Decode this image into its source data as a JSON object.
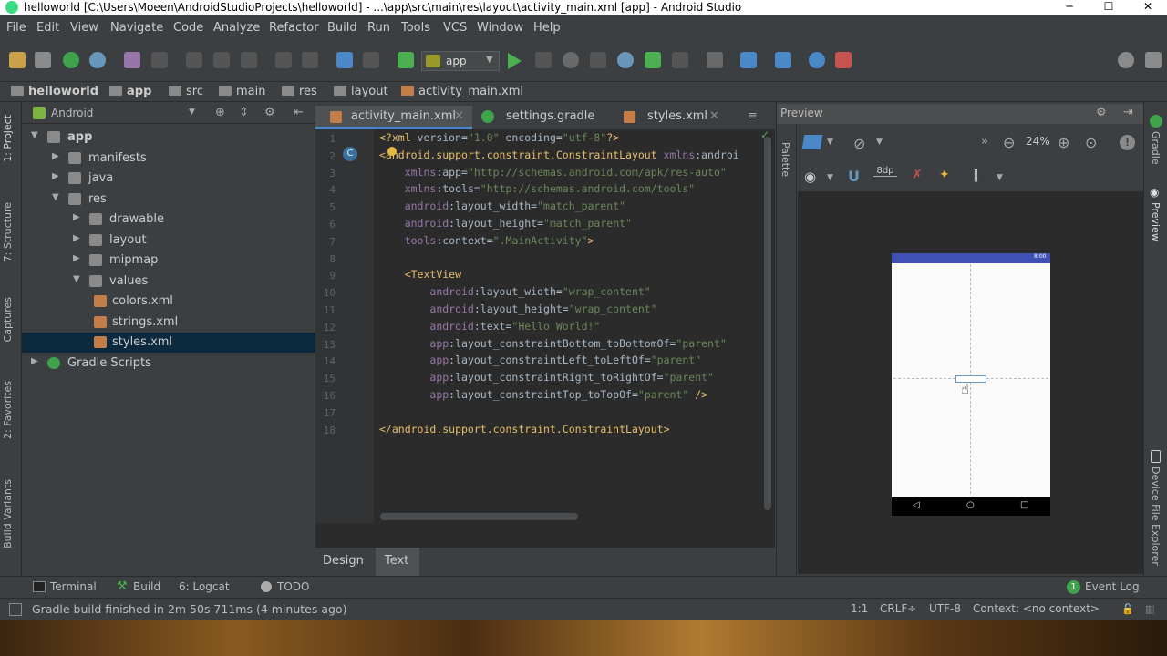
{
  "window": {
    "title": "helloworld [C:\\Users\\Moeen\\AndroidStudioProjects\\helloworld] - ...\\app\\src\\main\\res\\layout\\activity_main.xml [app] - Android Studio"
  },
  "menu": [
    "File",
    "Edit",
    "View",
    "Navigate",
    "Code",
    "Analyze",
    "Refactor",
    "Build",
    "Run",
    "Tools",
    "VCS",
    "Window",
    "Help"
  ],
  "toolbar": {
    "run_config": "app"
  },
  "breadcrumb": [
    "helloworld",
    "app",
    "src",
    "main",
    "res",
    "layout",
    "activity_main.xml"
  ],
  "project": {
    "view_mode": "Android",
    "tree": [
      {
        "label": "app",
        "depth": 0,
        "arrow": "down"
      },
      {
        "label": "manifests",
        "depth": 1,
        "arrow": "right"
      },
      {
        "label": "java",
        "depth": 1,
        "arrow": "right"
      },
      {
        "label": "res",
        "depth": 1,
        "arrow": "down"
      },
      {
        "label": "drawable",
        "depth": 2,
        "arrow": "right"
      },
      {
        "label": "layout",
        "depth": 2,
        "arrow": "right"
      },
      {
        "label": "mipmap",
        "depth": 2,
        "arrow": "right"
      },
      {
        "label": "values",
        "depth": 2,
        "arrow": "down"
      },
      {
        "label": "colors.xml",
        "depth": 3,
        "arrow": ""
      },
      {
        "label": "strings.xml",
        "depth": 3,
        "arrow": ""
      },
      {
        "label": "styles.xml",
        "depth": 3,
        "arrow": "",
        "selected": true
      },
      {
        "label": "Gradle Scripts",
        "depth": 0,
        "arrow": "right"
      }
    ]
  },
  "left_tabs": [
    "1: Project",
    "7: Structure",
    "Captures",
    "2: Favorites",
    "Build Variants"
  ],
  "editor": {
    "tabs": [
      "activity_main.xml",
      "settings.gradle",
      "styles.xml"
    ],
    "line_numbers": [
      "1",
      "2",
      "3",
      "4",
      "5",
      "6",
      "7",
      "8",
      "9",
      "10",
      "11",
      "12",
      "13",
      "14",
      "15",
      "16",
      "17",
      "18"
    ],
    "lines": [
      "<?xml version=\"1.0\" encoding=\"utf-8\"?>",
      "<android.support.constraint.ConstraintLayout xmlns:androi",
      "    xmlns:app=\"http://schemas.android.com/apk/res-auto\"",
      "    xmlns:tools=\"http://schemas.android.com/tools\"",
      "    android:layout_width=\"match_parent\"",
      "    android:layout_height=\"match_parent\"",
      "    tools:context=\".MainActivity\">",
      "",
      "    <TextView",
      "        android:layout_width=\"wrap_content\"",
      "        android:layout_height=\"wrap_content\"",
      "        android:text=\"Hello World!\"",
      "        app:layout_constraintBottom_toBottomOf=\"parent\"",
      "        app:layout_constraintLeft_toLeftOf=\"parent\"",
      "        app:layout_constraintRight_toRightOf=\"parent\"",
      "        app:layout_constraintTop_toTopOf=\"parent\" />",
      "",
      "</android.support.constraint.ConstraintLayout>"
    ],
    "bottom_tabs": [
      "Design",
      "Text"
    ]
  },
  "preview": {
    "title": "Preview",
    "zoom": "24%",
    "margin": "8dp",
    "palette_label": "Palette",
    "phone_time": "8:00"
  },
  "right_tabs": [
    "Gradle",
    "Preview",
    "Device File Explorer"
  ],
  "tool_windows": [
    "Terminal",
    "Build",
    "6: Logcat",
    "TODO"
  ],
  "event_log": "Event Log",
  "status": {
    "message": "Gradle build finished in 2m 50s 711ms (4 minutes ago)",
    "position": "1:1",
    "line_sep": "CRLF÷",
    "encoding": "UTF-8",
    "context": "Context: <no context>"
  },
  "colors": {
    "accent": "#4a88c7",
    "selection": "#0d293e",
    "run": "#4caf50"
  }
}
